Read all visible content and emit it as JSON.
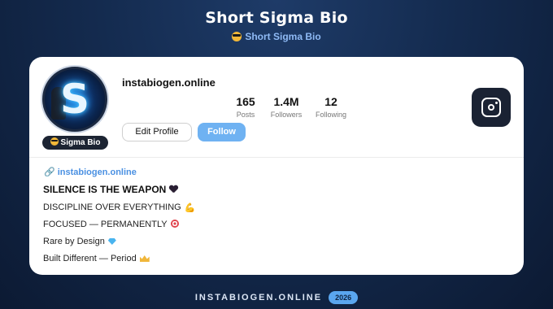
{
  "header": {
    "title": "Short Sigma Bio",
    "subtitle": "Short Sigma Bio",
    "subtitle_icon": "sunglasses-face-icon"
  },
  "profile": {
    "username": "instabiogen.online",
    "badge_label": "Sigma Bio",
    "stats": [
      {
        "value": "165",
        "label": "Posts"
      },
      {
        "value": "1.4M",
        "label": "Followers"
      },
      {
        "value": "12",
        "label": "Following"
      }
    ],
    "edit_button": "Edit Profile",
    "follow_button": "Follow",
    "follow_color": "#6fb2f2",
    "platform_icon": "instagram-icon"
  },
  "bio": {
    "link": "instabiogen.online",
    "headline": "SILENCE IS THE WEAPON",
    "lines": [
      "DISCIPLINE OVER EVERYTHING",
      "FOCUSED — PERMANENTLY",
      "Rare by Design",
      "Built Different — Period"
    ],
    "icons": [
      "black-heart-icon",
      "flexed-biceps-icon",
      "target-icon",
      "gem-icon",
      "crown-icon"
    ]
  },
  "footer": {
    "site": "INSTABIOGEN.ONLINE",
    "year": "2026"
  }
}
